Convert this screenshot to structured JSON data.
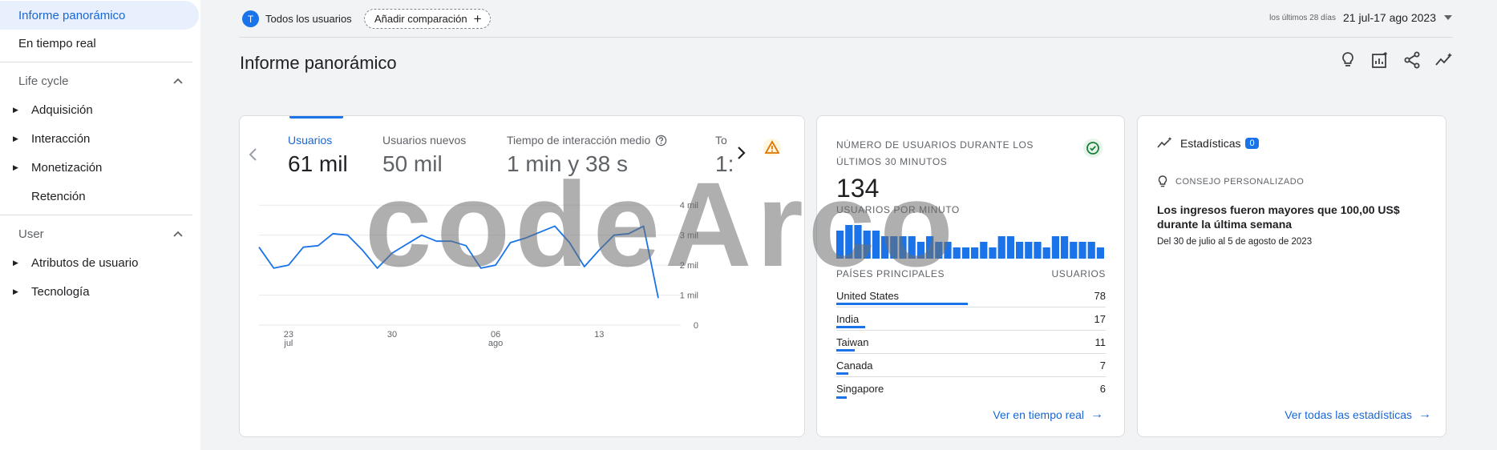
{
  "sidebar": {
    "overview": "Informe panorámico",
    "realtime": "En tiempo real",
    "sections": [
      {
        "title": "Life cycle",
        "items": [
          "Adquisición",
          "Interacción",
          "Monetización",
          "Retención"
        ]
      },
      {
        "title": "User",
        "items": [
          "Atributos de usuario",
          "Tecnología"
        ]
      }
    ]
  },
  "topbar": {
    "avatar_letter": "T",
    "segment": "Todos los usuarios",
    "add_comparison": "Añadir comparación",
    "date_caption": "los últimos 28 días",
    "date_range": "21 jul-17 ago 2023"
  },
  "page": {
    "title": "Informe panorámico"
  },
  "colors": {
    "accent": "#1a73e8",
    "line": "#1a73e8",
    "grid": "#e8eaed",
    "warning": "#e37400",
    "success": "#188038"
  },
  "metrics": {
    "tabs": [
      {
        "label": "Usuarios",
        "value": "61 mil"
      },
      {
        "label": "Usuarios nuevos",
        "value": "50 mil"
      },
      {
        "label": "Tiempo de interacción medio",
        "value": "1 min y 38 s"
      },
      {
        "label": "To",
        "value": "1:"
      }
    ]
  },
  "chart_data": {
    "type": "line",
    "x": [
      "2023-07-21",
      "2023-07-22",
      "2023-07-23",
      "2023-07-24",
      "2023-07-25",
      "2023-07-26",
      "2023-07-27",
      "2023-07-28",
      "2023-07-29",
      "2023-07-30",
      "2023-07-31",
      "2023-08-01",
      "2023-08-02",
      "2023-08-03",
      "2023-08-04",
      "2023-08-05",
      "2023-08-06",
      "2023-08-07",
      "2023-08-08",
      "2023-08-09",
      "2023-08-10",
      "2023-08-11",
      "2023-08-12",
      "2023-08-13",
      "2023-08-14",
      "2023-08-15",
      "2023-08-16",
      "2023-08-17"
    ],
    "series": [
      {
        "values": [
          2.6,
          1.9,
          2.0,
          2.6,
          2.65,
          3.05,
          3.0,
          2.5,
          1.9,
          2.4,
          2.7,
          3.0,
          2.8,
          2.8,
          2.65,
          1.9,
          2.0,
          2.75,
          2.9,
          3.1,
          3.3,
          2.75,
          1.95,
          2.5,
          3.0,
          3.05,
          3.3,
          0.9
        ]
      }
    ],
    "x_tick_labels": [
      {
        "day": "23",
        "month": "jul"
      },
      {
        "day": "30",
        "month": ""
      },
      {
        "day": "06",
        "month": "ago"
      },
      {
        "day": "13",
        "month": ""
      }
    ],
    "y_tick_labels": [
      "4 mil",
      "3 mil",
      "2 mil",
      "1 mil",
      "0"
    ],
    "ylim": [
      0,
      4.3
    ],
    "y_ticks": [
      4,
      3,
      2,
      1,
      0
    ],
    "y_units": "thousands of users",
    "grid": true
  },
  "realtime": {
    "title": "NÚMERO DE USUARIOS DURANTE LOS ÚLTIMOS 30 MINUTOS",
    "count": "134",
    "per_minute_label": "USUARIOS POR MINUTO",
    "per_minute": [
      5,
      6,
      6,
      5,
      5,
      4,
      4,
      4,
      4,
      3,
      4,
      3,
      3,
      2,
      2,
      2,
      3,
      2,
      4,
      4,
      3,
      3,
      3,
      2,
      4,
      4,
      3,
      3,
      3,
      2
    ],
    "countries_header": "PAÍSES PRINCIPALES",
    "users_header": "USUARIOS",
    "countries": [
      {
        "name": "United States",
        "users": "78",
        "share": 78
      },
      {
        "name": "India",
        "users": "17",
        "share": 17
      },
      {
        "name": "Taiwan",
        "users": "11",
        "share": 11
      },
      {
        "name": "Canada",
        "users": "7",
        "share": 7
      },
      {
        "name": "Singapore",
        "users": "6",
        "share": 6
      }
    ],
    "link": "Ver en tiempo real"
  },
  "insights": {
    "title": "Estadísticas",
    "badge": "0",
    "tip_label": "CONSEJO PERSONALIZADO",
    "text": "Los ingresos fueron mayores que 100,00 US$ durante la última semana",
    "date": "Del 30 de julio al 5 de agosto de 2023",
    "link": "Ver todas las estadísticas"
  },
  "watermark": "codeArco"
}
